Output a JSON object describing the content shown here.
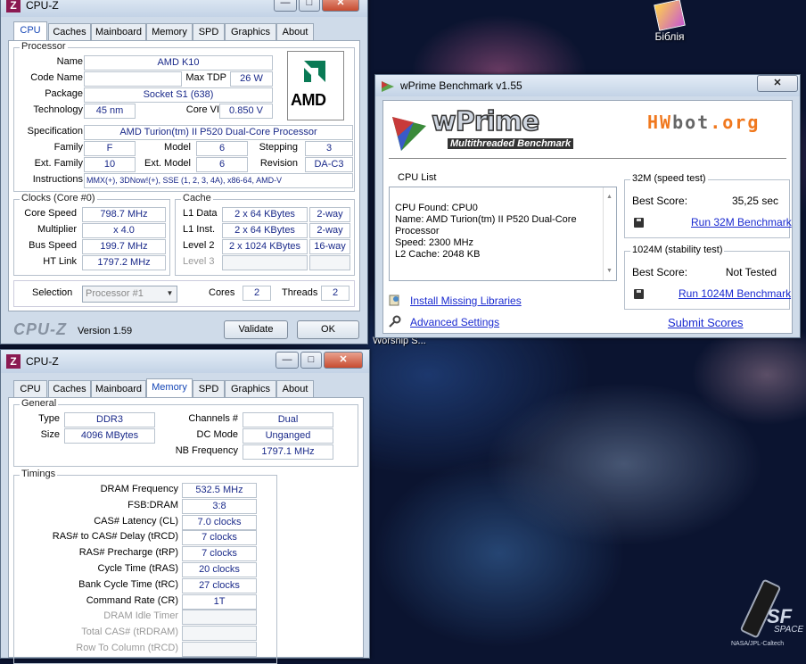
{
  "desktop": {
    "icon_label": "Біблія",
    "wallpaper_text": "Worship S...",
    "logo_text": "SF",
    "logo_sub": "SPACE",
    "credit": "NASA/JPL-Caltech"
  },
  "cpuz_top": {
    "title": "CPU-Z",
    "tabs": [
      "CPU",
      "Caches",
      "Mainboard",
      "Memory",
      "SPD",
      "Graphics",
      "About"
    ],
    "active_tab": "CPU",
    "processor": {
      "group_title": "Processor",
      "name_label": "Name",
      "name": "AMD K10",
      "codename_label": "Code Name",
      "codename": "",
      "maxtdp_label": "Max TDP",
      "maxtdp": "26 W",
      "package_label": "Package",
      "package": "Socket S1 (638)",
      "technology_label": "Technology",
      "technology": "45 nm",
      "corevid_label": "Core VID",
      "corevid": "0.850 V",
      "spec_label": "Specification",
      "spec": "AMD Turion(tm) II P520 Dual-Core Processor",
      "family_label": "Family",
      "family": "F",
      "model_label": "Model",
      "model": "6",
      "stepping_label": "Stepping",
      "stepping": "3",
      "extfamily_label": "Ext. Family",
      "extfamily": "10",
      "extmodel_label": "Ext. Model",
      "extmodel": "6",
      "revision_label": "Revision",
      "revision": "DA-C3",
      "instr_label": "Instructions",
      "instructions": "MMX(+), 3DNow!(+), SSE (1, 2, 3, 4A), x86-64, AMD-V",
      "logo": "AMD"
    },
    "clocks": {
      "group_title": "Clocks (Core #0)",
      "corespeed_label": "Core Speed",
      "corespeed": "798.7 MHz",
      "multiplier_label": "Multiplier",
      "multiplier": "x 4.0",
      "busspeed_label": "Bus Speed",
      "busspeed": "199.7 MHz",
      "htlink_label": "HT Link",
      "htlink": "1797.2 MHz"
    },
    "cache": {
      "group_title": "Cache",
      "l1d_label": "L1 Data",
      "l1d": "2 x 64 KBytes",
      "l1d_way": "2-way",
      "l1i_label": "L1 Inst.",
      "l1i": "2 x 64 KBytes",
      "l1i_way": "2-way",
      "l2_label": "Level 2",
      "l2": "2 x 1024 KBytes",
      "l2_way": "16-way",
      "l3_label": "Level 3"
    },
    "selection_label": "Selection",
    "selection": "Processor #1",
    "cores_label": "Cores",
    "cores": "2",
    "threads_label": "Threads",
    "threads": "2",
    "brand": "CPU-Z",
    "version": "Version 1.59",
    "validate": "Validate",
    "ok": "OK"
  },
  "cpuz_bottom": {
    "title": "CPU-Z",
    "tabs": [
      "CPU",
      "Caches",
      "Mainboard",
      "Memory",
      "SPD",
      "Graphics",
      "About"
    ],
    "active_tab": "Memory",
    "general": {
      "group_title": "General",
      "type_label": "Type",
      "type": "DDR3",
      "size_label": "Size",
      "size": "4096 MBytes",
      "channels_label": "Channels #",
      "channels": "Dual",
      "dcmode_label": "DC Mode",
      "dcmode": "Unganged",
      "nbfreq_label": "NB Frequency",
      "nbfreq": "1797.1 MHz"
    },
    "timings": {
      "group_title": "Timings",
      "rows": [
        {
          "label": "DRAM Frequency",
          "value": "532.5 MHz"
        },
        {
          "label": "FSB:DRAM",
          "value": "3:8"
        },
        {
          "label": "CAS# Latency (CL)",
          "value": "7.0 clocks"
        },
        {
          "label": "RAS# to CAS# Delay (tRCD)",
          "value": "7 clocks"
        },
        {
          "label": "RAS# Precharge (tRP)",
          "value": "7 clocks"
        },
        {
          "label": "Cycle Time (tRAS)",
          "value": "20 clocks"
        },
        {
          "label": "Bank Cycle Time (tRC)",
          "value": "27 clocks"
        },
        {
          "label": "Command Rate (CR)",
          "value": "1T"
        },
        {
          "label": "DRAM Idle Timer",
          "value": ""
        },
        {
          "label": "Total CAS# (tRDRAM)",
          "value": ""
        },
        {
          "label": "Row To Column (tRCD)",
          "value": ""
        }
      ]
    }
  },
  "wprime": {
    "title": "wPrime Benchmark v1.55",
    "logo_title": "wPrime",
    "logo_sub": "Multithreaded Benchmark",
    "hwbot_hw": "HW",
    "hwbot_bot": "bot",
    "hwbot_org": ".org",
    "cpulist_title": "CPU List",
    "cpulist_text": "CPU Found: CPU0\nName:   AMD Turion(tm) II P520 Dual-Core Processor\nSpeed:  2300 MHz\nL2 Cache: 2048 KB",
    "t32_title": "32M (speed test)",
    "t32_best_label": "Best Score:",
    "t32_best": "35,25 sec",
    "t32_run": "Run 32M Benchmark",
    "t1024_title": "1024M (stability test)",
    "t1024_best_label": "Best Score:",
    "t1024_best": "Not Tested",
    "t1024_run": "Run 1024M Benchmark",
    "install": "Install Missing Libraries",
    "advanced": "Advanced Settings",
    "submit": "Submit Scores"
  }
}
